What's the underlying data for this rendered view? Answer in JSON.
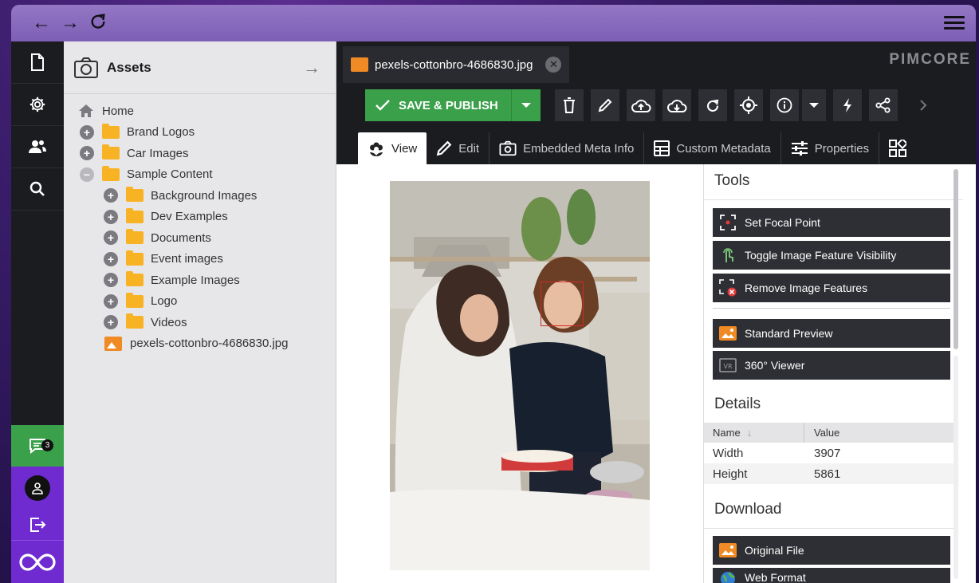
{
  "browser": {
    "back": "←",
    "forward": "→",
    "reload": "C"
  },
  "leftnav": {
    "messages_count": "3"
  },
  "tree": {
    "title": "Assets",
    "nodes": [
      {
        "label": "Home"
      },
      {
        "label": "Brand Logos"
      },
      {
        "label": "Car Images"
      },
      {
        "label": "Sample Content"
      },
      {
        "label": "Background Images"
      },
      {
        "label": "Dev Examples"
      },
      {
        "label": "Documents"
      },
      {
        "label": "Event images"
      },
      {
        "label": "Example Images"
      },
      {
        "label": "Logo"
      },
      {
        "label": "Videos"
      },
      {
        "label": "pexels-cottonbro-4686830.jpg"
      }
    ]
  },
  "tabs": {
    "file_tab": "pexels-cottonbro-4686830.jpg",
    "brand": "PIMCORE"
  },
  "toolbar": {
    "save_label": "SAVE & PUBLISH"
  },
  "subtabs": [
    "View",
    "Edit",
    "Embedded Meta Info",
    "Custom Metadata",
    "Properties"
  ],
  "panel": {
    "tools_title": "Tools",
    "tools": [
      "Set Focal Point",
      "Toggle Image Feature Visibility",
      "Remove Image Features",
      "Standard Preview",
      "360° Viewer"
    ],
    "details_title": "Details",
    "details_headers": {
      "name": "Name",
      "value": "Value"
    },
    "details": [
      {
        "name": "Width",
        "value": "3907"
      },
      {
        "name": "Height",
        "value": "5861"
      }
    ],
    "download_title": "Download",
    "downloads": [
      "Original File",
      "Web Format"
    ]
  },
  "colors": {
    "accent_green": "#3aa04a",
    "purple": "#6f2bd0",
    "folder": "#f7b324",
    "image_icon": "#f08a24",
    "focal": "#d02a2a"
  }
}
